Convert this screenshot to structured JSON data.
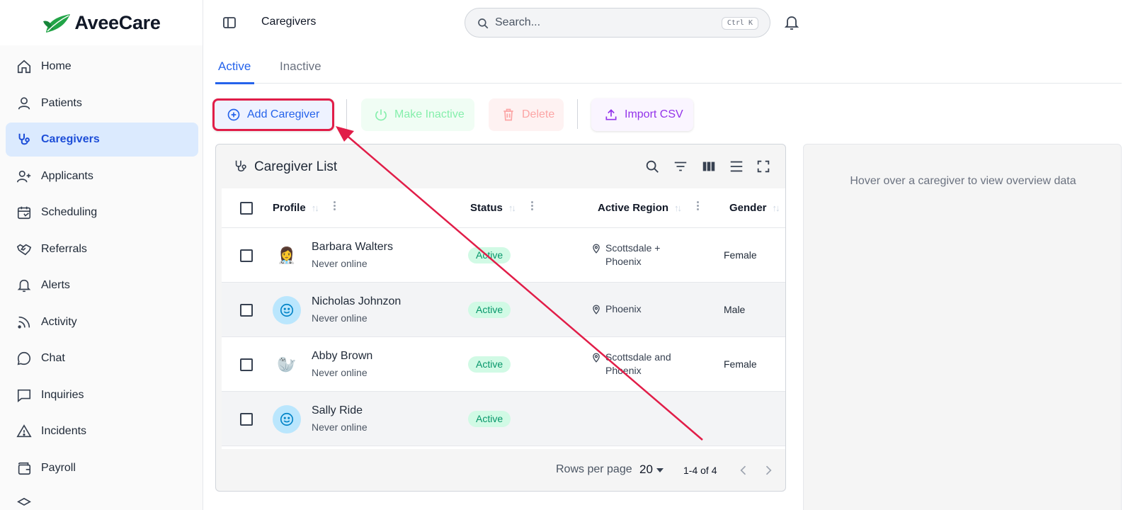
{
  "app": {
    "brand": "AveeCare",
    "page_title": "Caregivers"
  },
  "sidebar": {
    "items": [
      {
        "label": "Home",
        "icon": "home-icon"
      },
      {
        "label": "Patients",
        "icon": "user-icon"
      },
      {
        "label": "Caregivers",
        "icon": "stethoscope-icon",
        "active": true
      },
      {
        "label": "Applicants",
        "icon": "user-plus-icon"
      },
      {
        "label": "Scheduling",
        "icon": "calendar-icon"
      },
      {
        "label": "Referrals",
        "icon": "handshake-icon"
      },
      {
        "label": "Alerts",
        "icon": "bell-icon"
      },
      {
        "label": "Activity",
        "icon": "rss-icon"
      },
      {
        "label": "Chat",
        "icon": "chat-icon"
      },
      {
        "label": "Inquiries",
        "icon": "message-square-icon"
      },
      {
        "label": "Incidents",
        "icon": "warning-icon"
      },
      {
        "label": "Payroll",
        "icon": "wallet-icon"
      }
    ]
  },
  "search": {
    "placeholder": "Search...",
    "shortcut": "Ctrl K"
  },
  "tabs": [
    {
      "label": "Active",
      "active": true
    },
    {
      "label": "Inactive"
    }
  ],
  "toolbar": {
    "add_label": "Add Caregiver",
    "inactive_label": "Make Inactive",
    "delete_label": "Delete",
    "import_label": "Import CSV"
  },
  "table": {
    "title": "Caregiver List",
    "columns": [
      "Profile",
      "Status",
      "Active Region",
      "Gender"
    ],
    "rows": [
      {
        "name": "Barbara Walters",
        "sub": "Never online",
        "status": "Active",
        "region_line1": "Scottsdale +",
        "region_line2": "Phoenix",
        "gender": "Female",
        "avatar": "👩‍⚕️"
      },
      {
        "name": "Nicholas Johnzon",
        "sub": "Never online",
        "status": "Active",
        "region_line1": "Phoenix",
        "region_line2": "",
        "gender": "Male",
        "avatar": "☺"
      },
      {
        "name": "Abby Brown",
        "sub": "Never online",
        "status": "Active",
        "region_line1": "Scottsdale and",
        "region_line2": "Phoenix",
        "gender": "Female",
        "avatar": "🦭"
      },
      {
        "name": "Sally Ride",
        "sub": "Never online",
        "status": "Active",
        "region_line1": "",
        "region_line2": "",
        "gender": "",
        "avatar": "☺"
      }
    ],
    "footer": {
      "rows_per_page_label": "Rows per page",
      "rows_per_page": "20",
      "range": "1-4 of 4"
    }
  },
  "overview": {
    "message": "Hover over a caregiver to view overview data"
  },
  "colors": {
    "accent": "#2563eb",
    "highlight": "#e11d48",
    "active_badge_bg": "#d1fae5",
    "active_badge_text": "#059669"
  }
}
